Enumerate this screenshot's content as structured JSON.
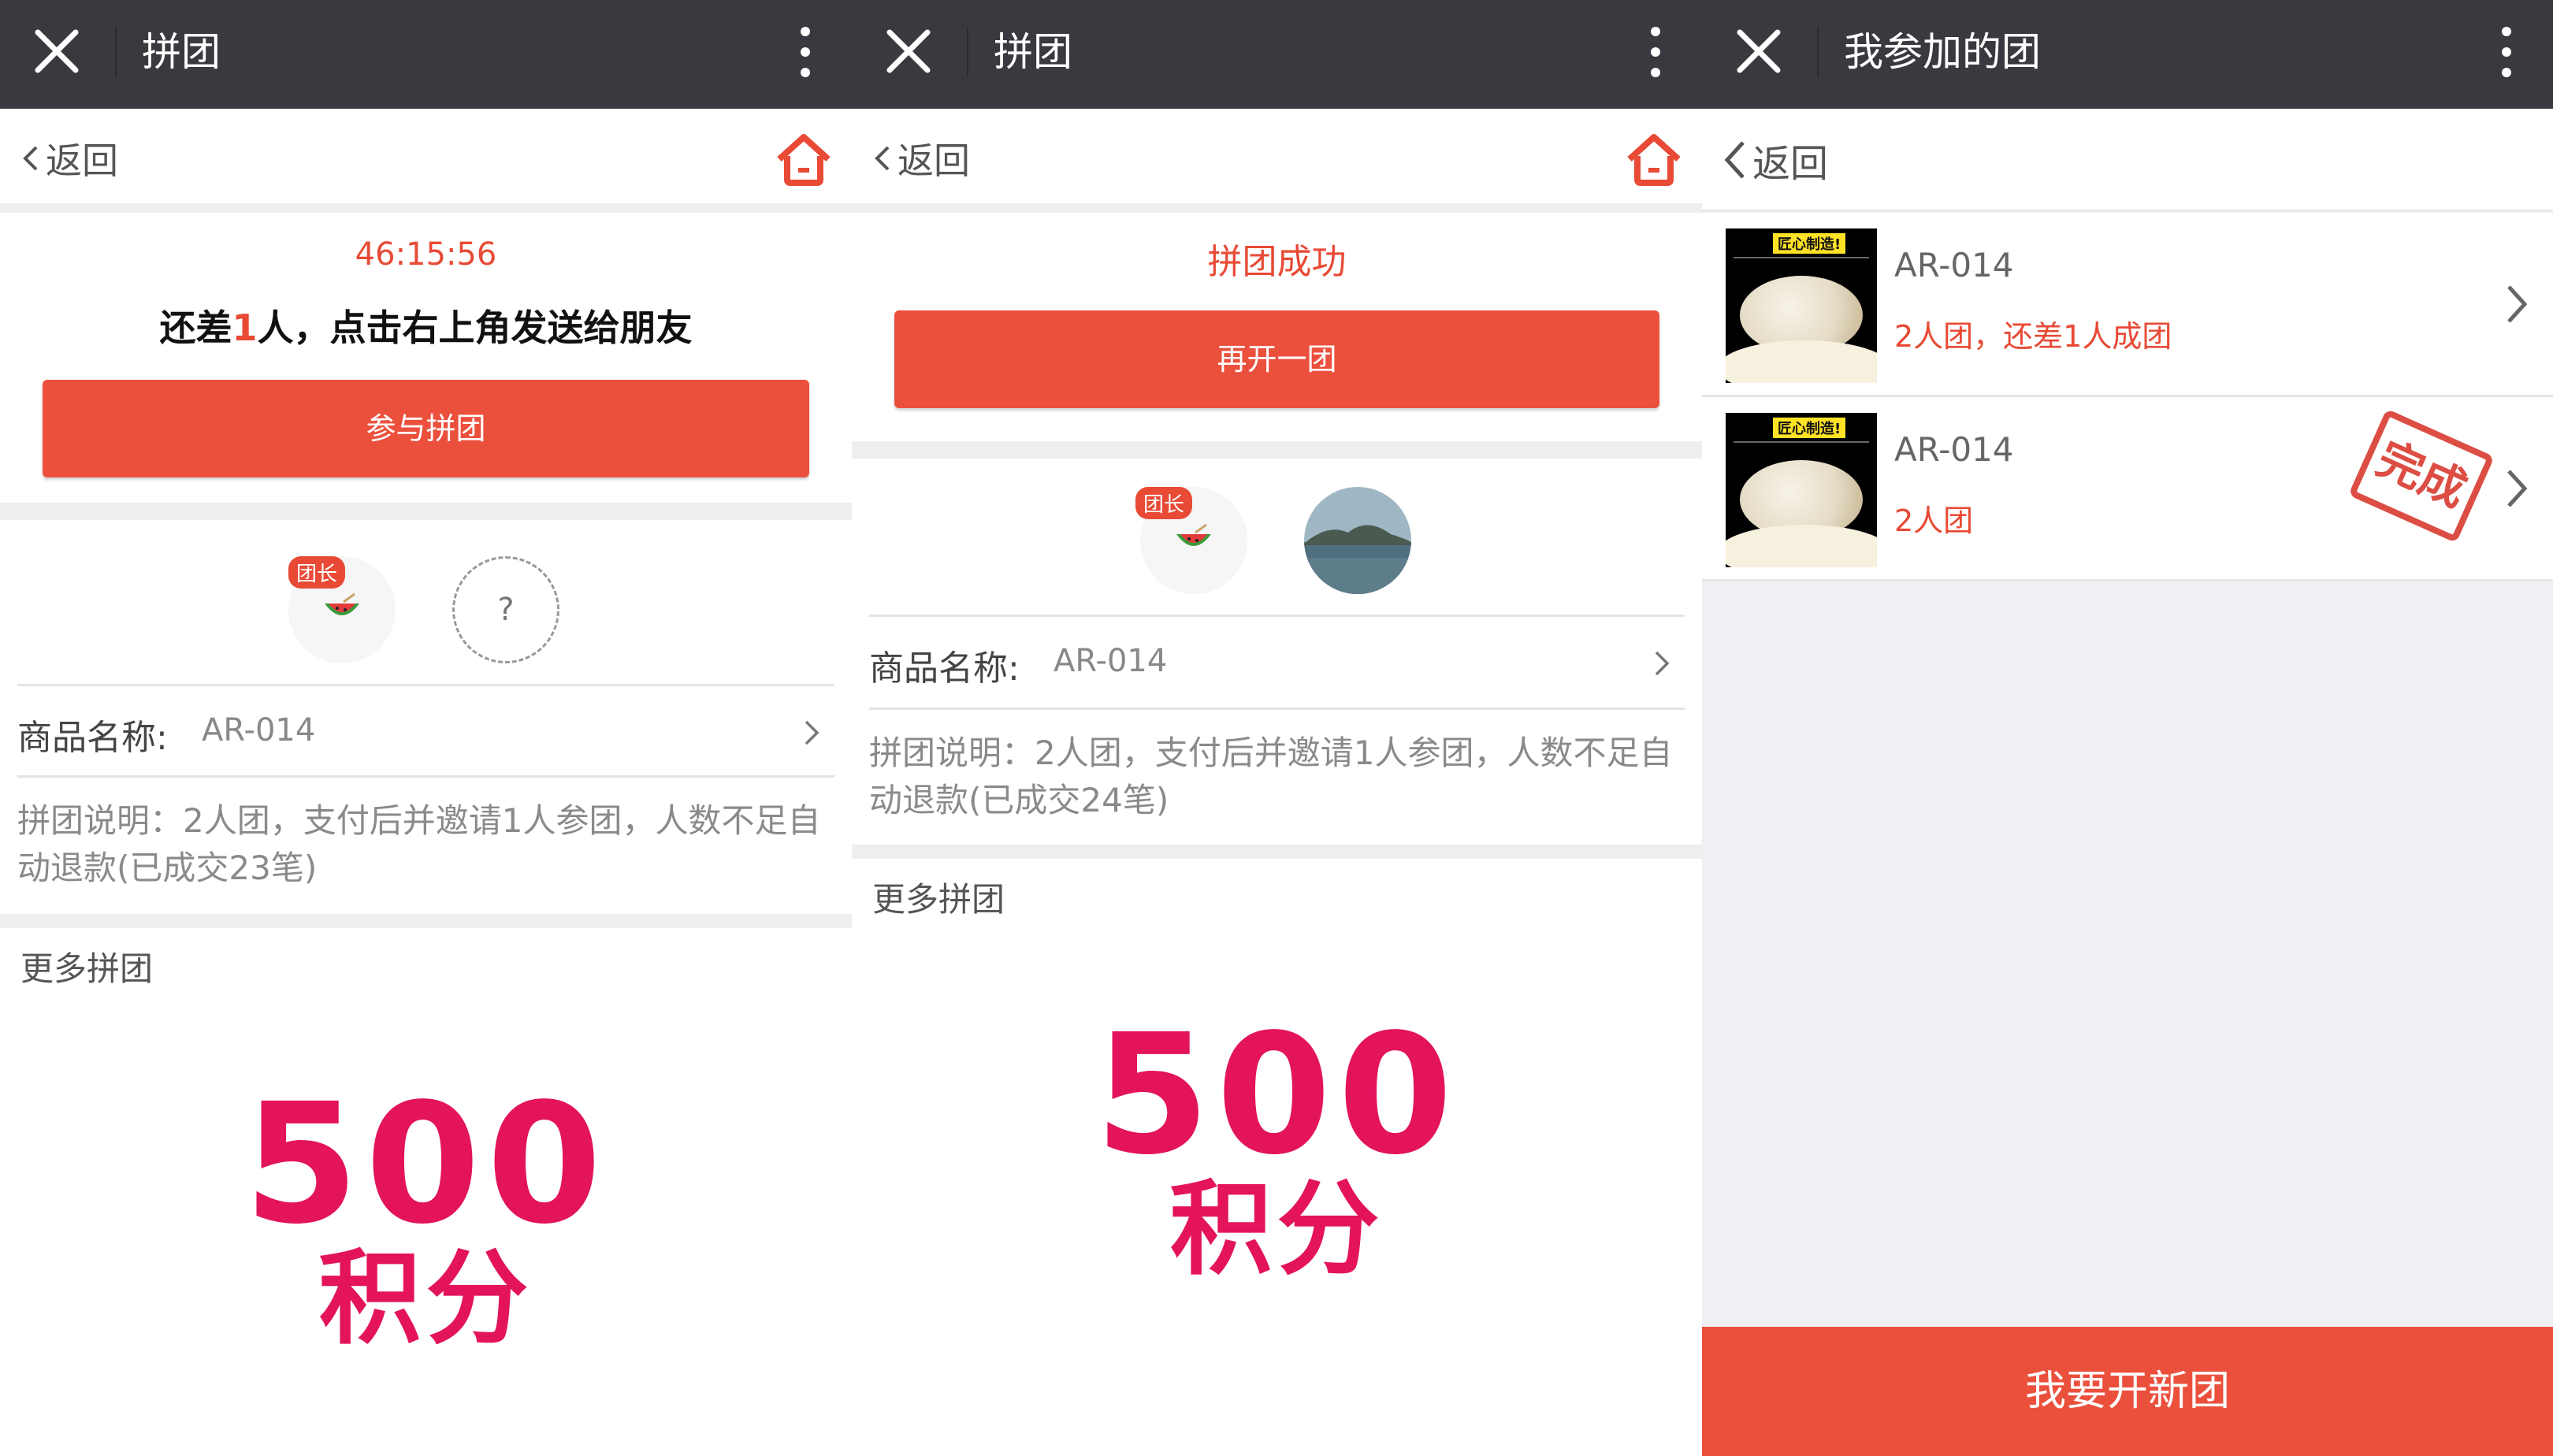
{
  "panels": [
    {
      "window_title": "拼团",
      "back_label": "返回",
      "countdown": "46:15:56",
      "remain": {
        "pre": "还差",
        "num": "1",
        "post": "人，点击右上角发送给朋友"
      },
      "action_label": "参与拼团",
      "leader_badge": "团长",
      "unknown_member": "?",
      "product_label": "商品名称:",
      "product_value": "AR-014",
      "description": "拼团说明：2人团，支付后并邀请1人参团，人数不足自动退款(已成交23笔)",
      "more_title": "更多拼团",
      "promo": {
        "number": "500",
        "unit": "积分"
      }
    },
    {
      "window_title": "拼团",
      "back_label": "返回",
      "status_title": "拼团成功",
      "action_label": "再开一团",
      "leader_badge": "团长",
      "product_label": "商品名称:",
      "product_value": "AR-014",
      "description": "拼团说明：2人团，支付后并邀请1人参团，人数不足自动退款(已成交24笔)",
      "more_title": "更多拼团",
      "promo": {
        "number": "500",
        "unit": "积分"
      }
    },
    {
      "window_title": "我参加的团",
      "back_label": "返回",
      "items": [
        {
          "name": "AR-014",
          "subtitle": "2人团，还差1人成团",
          "badge": "",
          "thumb_tag": "匠心制造!"
        },
        {
          "name": "AR-014",
          "subtitle": "2人团",
          "badge": "完成",
          "thumb_tag": "匠心制造!"
        }
      ],
      "footer_label": "我要开新团"
    }
  ],
  "colors": {
    "accent": "#eb503d",
    "titlebar": "#393a3f",
    "promo": "#e3135c"
  }
}
